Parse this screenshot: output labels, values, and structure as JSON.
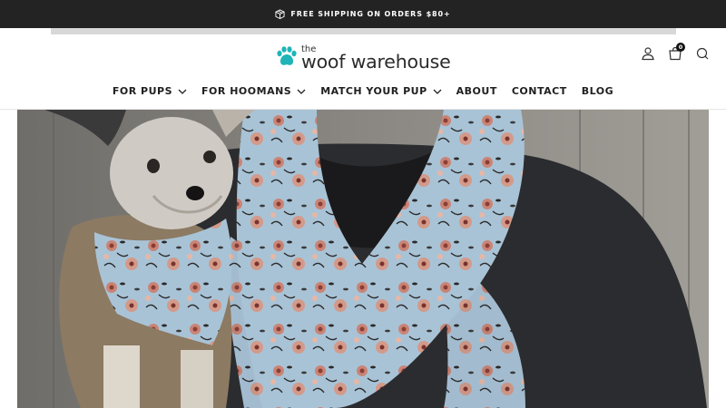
{
  "announcement": {
    "icon": "box-icon",
    "text": "FREE SHIPPING ON ORDERS $80+"
  },
  "header": {
    "logo": {
      "the": "the",
      "name": "woof warehouse",
      "icon": "paw-icon",
      "paw_color": "#1fb5b8"
    },
    "icons": [
      {
        "name": "account-icon"
      },
      {
        "name": "cart-icon",
        "count": "0"
      },
      {
        "name": "search-icon"
      }
    ]
  },
  "nav": {
    "items": [
      {
        "label": "FOR PUPS",
        "dropdown": true
      },
      {
        "label": "FOR HOOMANS",
        "dropdown": true
      },
      {
        "label": "MATCH YOUR PUP",
        "dropdown": true
      },
      {
        "label": "ABOUT",
        "dropdown": false
      },
      {
        "label": "CONTACT",
        "dropdown": false
      },
      {
        "label": "BLOG",
        "dropdown": false
      }
    ]
  },
  "hero": {
    "description": "",
    "colors": {
      "scarf": "#a9c3d6",
      "flower": "#c98476",
      "shirt": "#2b2c2f"
    }
  }
}
